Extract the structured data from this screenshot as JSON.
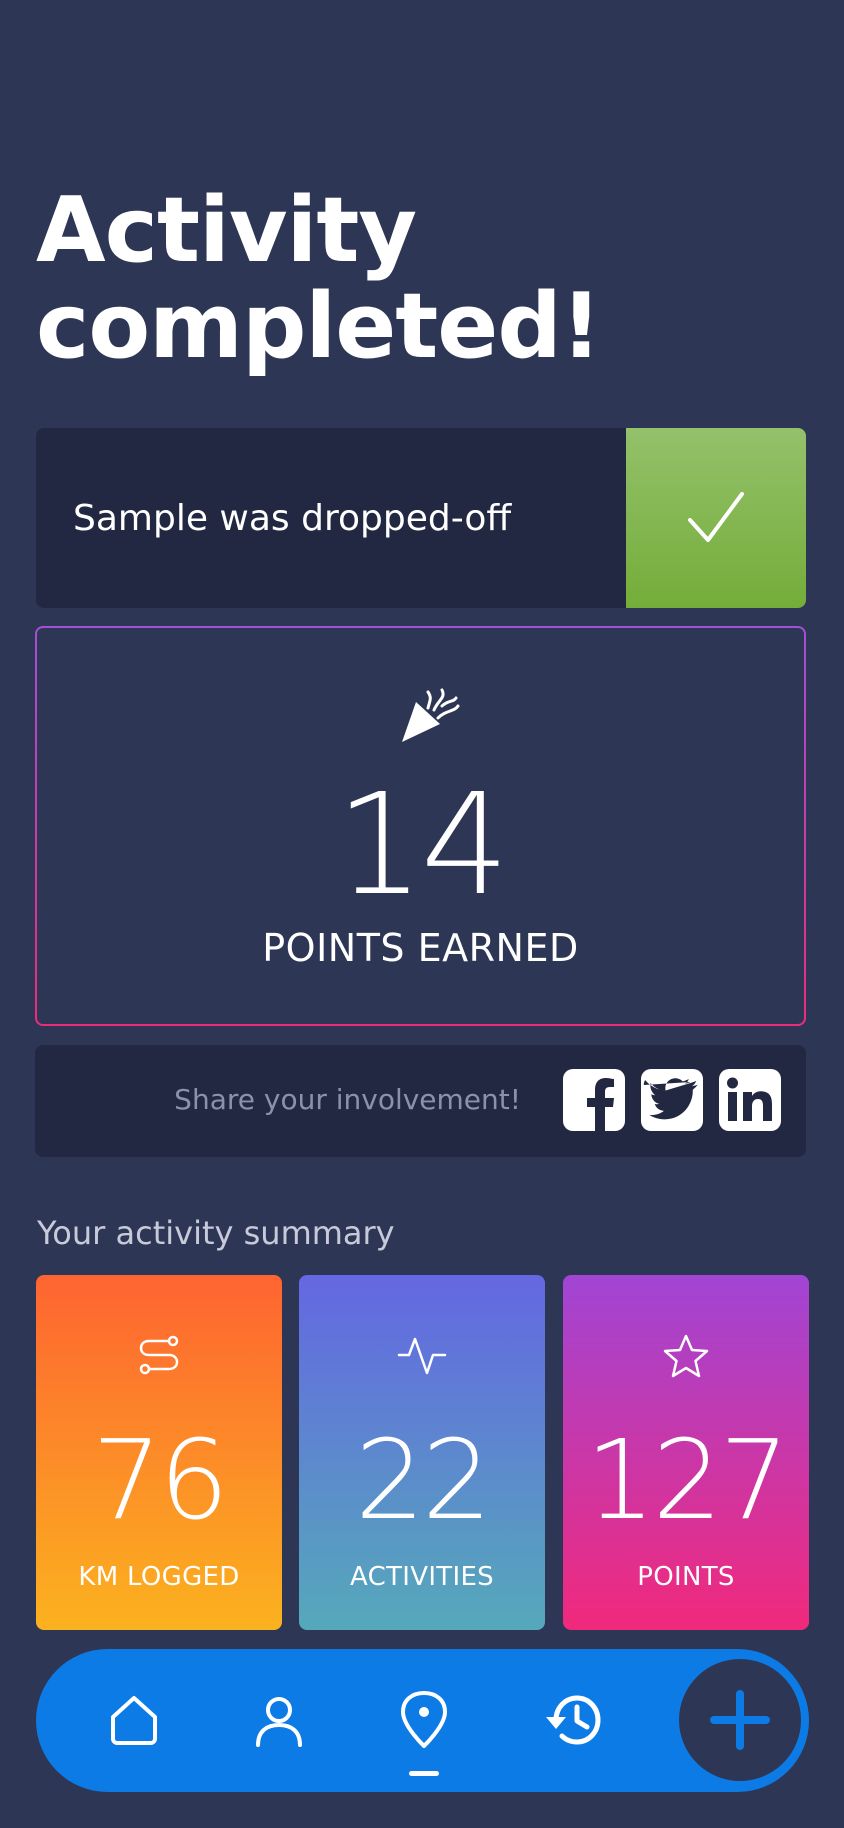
{
  "header": {
    "title_line1": "Activity",
    "title_line2": "completed!"
  },
  "status": {
    "message": "Sample was dropped-off",
    "icon": "check-icon",
    "color": "#7db046"
  },
  "points": {
    "icon": "party-popper-icon",
    "value": "14",
    "label": "POINTS EARNED"
  },
  "share": {
    "prompt": "Share your involvement!",
    "networks": [
      {
        "name": "facebook-icon"
      },
      {
        "name": "twitter-icon"
      },
      {
        "name": "linkedin-icon"
      }
    ]
  },
  "summary": {
    "label": "Your activity summary",
    "tiles": [
      {
        "icon": "route-icon",
        "value": "76",
        "label": "KM LOGGED"
      },
      {
        "icon": "pulse-icon",
        "value": "22",
        "label": "ACTIVITIES"
      },
      {
        "icon": "star-icon",
        "value": "127",
        "label": "POINTS"
      }
    ]
  },
  "nav": {
    "items": [
      {
        "icon": "home-icon"
      },
      {
        "icon": "user-icon"
      },
      {
        "icon": "location-pin-icon",
        "active": true
      },
      {
        "icon": "history-icon"
      }
    ],
    "fab_icon": "plus-icon",
    "accent": "#0d7be6"
  }
}
